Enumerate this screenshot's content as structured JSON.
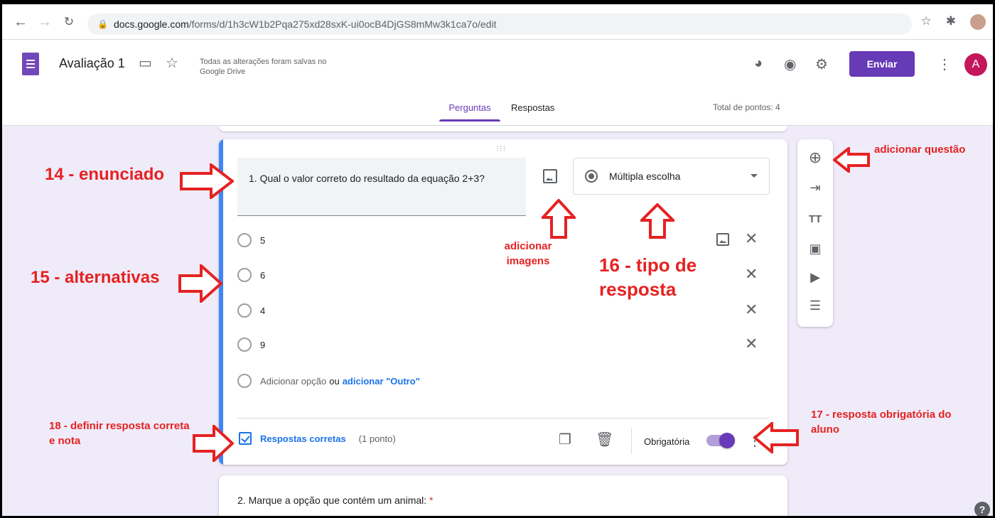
{
  "browser": {
    "url_host": "docs.google.com",
    "url_path": "/forms/d/1h3cW1b2Pqa275xd28sxK-ui0ocB4DjGS8mMw3k1ca7o/edit"
  },
  "header": {
    "title": "Avaliação 1",
    "save_status": "Todas as alterações foram salvas no Google Drive",
    "send_label": "Enviar",
    "avatar_letter": "A",
    "accent_color": "#673ab7"
  },
  "tabs": [
    {
      "label": "Perguntas",
      "active": true
    },
    {
      "label": "Respostas",
      "active": false
    }
  ],
  "total_points": "Total de pontos: 4",
  "question": {
    "title": "1. Qual o valor correto do resultado da equação 2+3?",
    "type": "Múltipla escolha",
    "options": [
      "5",
      "6",
      "4",
      "9"
    ],
    "add_option": "Adicionar opção",
    "or": "ou",
    "add_other": "adicionar \"Outro\"",
    "answer_key": "Respostas corretas",
    "points": "(1 ponto)",
    "required_label": "Obrigatória"
  },
  "question2": {
    "title": "2. Marque a opção que contém um animal:",
    "required_mark": "*"
  },
  "annotations": {
    "a14": "14 - enunciado",
    "a15": "15 - alternativas",
    "a16": "16 - tipo de resposta",
    "a17": "17 - resposta obrigatória do aluno",
    "a18": "18 - definir resposta correta e nota",
    "add_image": "adicionar imagens",
    "add_question": "adicionar questão"
  }
}
